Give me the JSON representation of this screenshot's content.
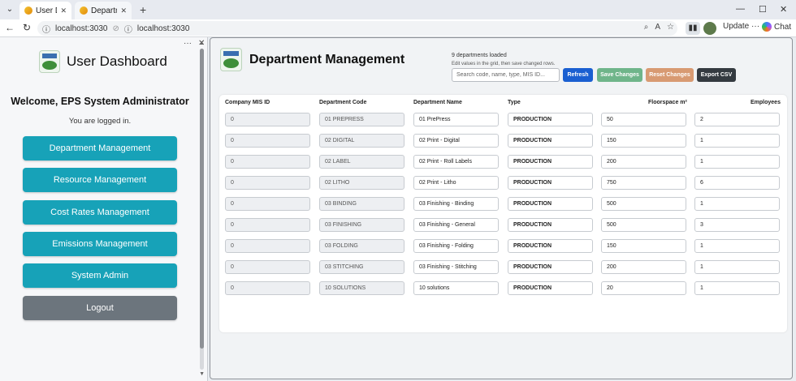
{
  "browser": {
    "tabs": [
      {
        "label": "User Dashbo"
      },
      {
        "label": "Departmen"
      }
    ],
    "url_left": "localhost:3030",
    "url_main": "localhost:3030",
    "update_label": "Update",
    "chat_label": "Chat"
  },
  "sidebar": {
    "title": "User Dashboard",
    "welcome": "Welcome, EPS System Administrator",
    "status": "You are logged in.",
    "nav": [
      {
        "label": "Department Management"
      },
      {
        "label": "Resource Management"
      },
      {
        "label": "Cost Rates Management"
      },
      {
        "label": "Emissions Management"
      },
      {
        "label": "System Admin"
      }
    ],
    "logout": "Logout"
  },
  "main": {
    "title": "Department Management",
    "count_text": "9 departments loaded",
    "hint": "Edit values in the grid, then save changed rows.",
    "search_placeholder": "Search code, name, type, MIS ID...",
    "buttons": {
      "refresh": "Refresh",
      "save": "Save Changes",
      "reset": "Reset Changes",
      "export": "Export CSV"
    },
    "columns": [
      "Company MIS ID",
      "Department Code",
      "Department Name",
      "Type",
      "Floorspace m²",
      "Employees"
    ],
    "rows": [
      {
        "mis_id": "0",
        "code": "01 PREPRESS",
        "name": "01 PrePress",
        "type": "PRODUCTION",
        "floorspace": "50",
        "employees": "2"
      },
      {
        "mis_id": "0",
        "code": "02 DIGITAL",
        "name": "02 Print - Digital",
        "type": "PRODUCTION",
        "floorspace": "150",
        "employees": "1"
      },
      {
        "mis_id": "0",
        "code": "02 LABEL",
        "name": "02 Print - Roll Labels",
        "type": "PRODUCTION",
        "floorspace": "200",
        "employees": "1"
      },
      {
        "mis_id": "0",
        "code": "02 LITHO",
        "name": "02 Print - Litho",
        "type": "PRODUCTION",
        "floorspace": "750",
        "employees": "6"
      },
      {
        "mis_id": "0",
        "code": "03 BINDING",
        "name": "03 Finishing - Binding",
        "type": "PRODUCTION",
        "floorspace": "500",
        "employees": "1"
      },
      {
        "mis_id": "0",
        "code": "03 FINISHING",
        "name": "03 Finishing - General",
        "type": "PRODUCTION",
        "floorspace": "500",
        "employees": "3"
      },
      {
        "mis_id": "0",
        "code": "03 FOLDING",
        "name": "03 Finishing - Folding",
        "type": "PRODUCTION",
        "floorspace": "150",
        "employees": "1"
      },
      {
        "mis_id": "0",
        "code": "03 STITCHING",
        "name": "03 Finishing - Stitching",
        "type": "PRODUCTION",
        "floorspace": "200",
        "employees": "1"
      },
      {
        "mis_id": "0",
        "code": "10 SOLUTIONS",
        "name": "10 solutions",
        "type": "PRODUCTION",
        "floorspace": "20",
        "employees": "1"
      }
    ]
  },
  "colors": {
    "accent": "#17a2b8",
    "refresh": "#1a5fd1",
    "save": "#6fb58a",
    "reset": "#d89a72",
    "export": "#343a40",
    "logout": "#6c757d"
  }
}
